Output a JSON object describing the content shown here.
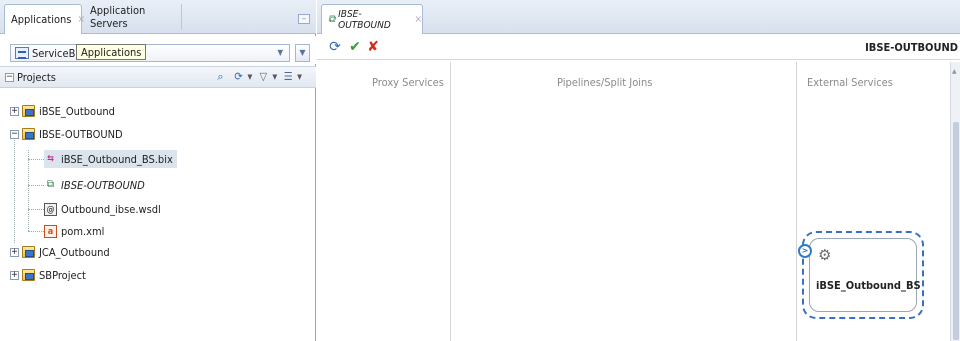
{
  "left_panel": {
    "tabs": [
      {
        "label": "Applications",
        "close": "×"
      },
      {
        "label": "Application Servers"
      }
    ],
    "application_select": {
      "value": "ServiceBus",
      "tooltip": "Applications"
    },
    "projects_header": {
      "label": "Projects"
    },
    "tree": [
      {
        "label": "iBSE_Outbound",
        "type": "project",
        "expanded": false
      },
      {
        "label": "IBSE-OUTBOUND",
        "type": "project",
        "expanded": true
      },
      {
        "label": "iBSE_Outbound_BS.bix",
        "type": "business-service",
        "selected": true
      },
      {
        "label": "IBSE-OUTBOUND",
        "type": "pipeline",
        "italic": true
      },
      {
        "label": "Outbound_ibse.wsdl",
        "type": "wsdl"
      },
      {
        "label": "pom.xml",
        "type": "xml"
      },
      {
        "label": "JCA_Outbound",
        "type": "project",
        "expanded": false
      },
      {
        "label": "SBProject",
        "type": "project",
        "expanded": false
      }
    ]
  },
  "editor": {
    "tab": {
      "label": "IBSE-OUTBOUND",
      "close": "×"
    },
    "title": "IBSE-OUTBOUND",
    "columns": {
      "proxy": "Proxy Services",
      "pipelines": "Pipelines/Split Joins",
      "external": "External Services"
    },
    "external_service": {
      "label": "iBSE_Outbound_BS"
    }
  },
  "icons": {
    "refresh": "refresh-icon",
    "validate": "check-icon",
    "cancel": "cross-icon"
  },
  "colors": {
    "selection_border": "#3a6fc5",
    "accent_blue": "#3468b8",
    "check_green": "#2f9d2f",
    "cross_red": "#d42a1a"
  }
}
